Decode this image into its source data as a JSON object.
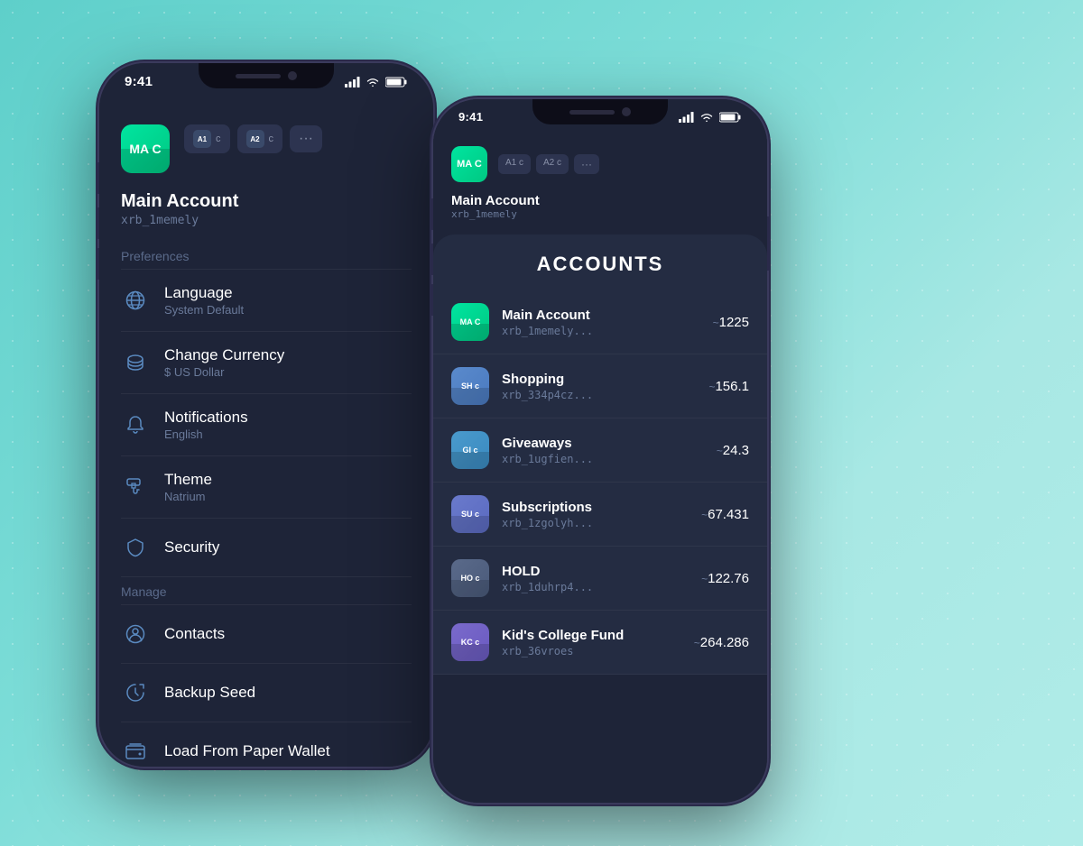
{
  "background": {
    "color": "#5ecfca"
  },
  "phone_left": {
    "status_bar": {
      "time": "9:41"
    },
    "account": {
      "avatar_letters": "MA C",
      "name": "Main Account",
      "address": "xrb_1memely",
      "tabs": [
        {
          "label": "A1 c"
        },
        {
          "label": "A2 c"
        }
      ]
    },
    "preferences_label": "Preferences",
    "menu_items": [
      {
        "id": "language",
        "title": "Language",
        "subtitle": "System Default",
        "icon": "globe"
      },
      {
        "id": "currency",
        "title": "Change Currency",
        "subtitle": "$ US Dollar",
        "icon": "coins"
      },
      {
        "id": "notifications",
        "title": "Notifications",
        "subtitle": "English",
        "icon": "bell"
      },
      {
        "id": "theme",
        "title": "Theme",
        "subtitle": "Natrium",
        "icon": "paint-roller"
      },
      {
        "id": "security",
        "title": "Security",
        "subtitle": "",
        "icon": "shield"
      }
    ],
    "manage_label": "Manage",
    "manage_items": [
      {
        "id": "contacts",
        "title": "Contacts",
        "icon": "person-circle"
      },
      {
        "id": "backup",
        "title": "Backup Seed",
        "icon": "backup"
      },
      {
        "id": "paper-wallet",
        "title": "Load From Paper Wallet",
        "icon": "wallet"
      }
    ]
  },
  "phone_right": {
    "status_bar": {
      "time": "9:41"
    },
    "account": {
      "avatar_letters": "MA C",
      "name": "Main Account",
      "address": "xrb_1memely",
      "tabs": [
        {
          "label": "A1 c"
        },
        {
          "label": "A2 c"
        }
      ]
    },
    "accounts_title": "ACCOUNTS",
    "accounts": [
      {
        "id": "main",
        "avatar": "MA C",
        "color": "green",
        "name": "Main Account",
        "address": "xrb_1memely...",
        "balance": "1225"
      },
      {
        "id": "shopping",
        "avatar": "SH c",
        "color": "blue",
        "name": "Shopping",
        "address": "xrb_334p4cz...",
        "balance": "156.1"
      },
      {
        "id": "giveaways",
        "avatar": "GI c",
        "color": "teal",
        "name": "Giveaways",
        "address": "xrb_1ugfien...",
        "balance": "24.3"
      },
      {
        "id": "subscriptions",
        "avatar": "SU c",
        "color": "indigo",
        "name": "Subscriptions",
        "address": "xrb_1zgolyh...",
        "balance": "67.431"
      },
      {
        "id": "hold",
        "avatar": "HO c",
        "color": "slate",
        "name": "HOLD",
        "address": "xrb_1duhrp4...",
        "balance": "122.76"
      },
      {
        "id": "kids-college",
        "avatar": "KC c",
        "color": "purple",
        "name": "Kid's College Fund",
        "address": "xrb_36vroes",
        "balance": "264.286"
      }
    ]
  }
}
